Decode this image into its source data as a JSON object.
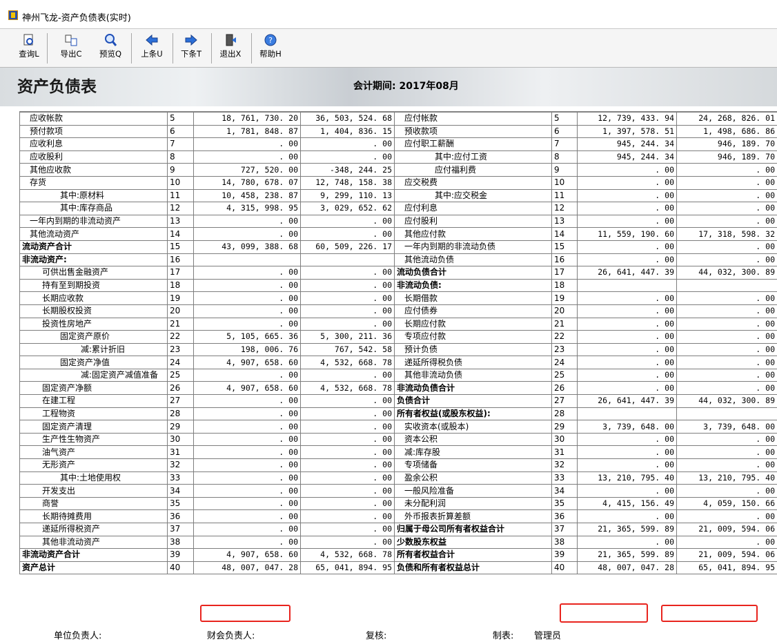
{
  "window": {
    "title": "神州飞龙-资产负债表(实时)"
  },
  "toolbar": [
    {
      "label": "查询L",
      "icon": "magnify-doc-icon"
    },
    {
      "label": "导出C",
      "icon": "export-icon"
    },
    {
      "label": "预览Q",
      "icon": "preview-magnifier-icon"
    },
    {
      "label": "上条U",
      "icon": "arrow-left-icon"
    },
    {
      "label": "下条T",
      "icon": "arrow-right-icon"
    },
    {
      "label": "退出X",
      "icon": "exit-door-icon"
    },
    {
      "label": "帮助H",
      "icon": "help-icon"
    }
  ],
  "banner": {
    "title": "资产负债表",
    "period": "会计期间: 2017年08月"
  },
  "rows": [
    {
      "ln": "应收帐款",
      "li": 1,
      "lb": false,
      "lr": "5",
      "lv1": "18, 761, 730. 20",
      "lv2": "36, 503, 524. 68",
      "rn": "应付帐款",
      "ri": 1,
      "rb": false,
      "rr": "5",
      "rv1": "12, 739, 433. 94",
      "rv2": "24, 268, 826. 01"
    },
    {
      "ln": "预付款项",
      "li": 1,
      "lb": false,
      "lr": "6",
      "lv1": "1, 781, 848. 87",
      "lv2": "1, 404, 836. 15",
      "rn": "预收款项",
      "ri": 1,
      "rb": false,
      "rr": "6",
      "rv1": "1, 397, 578. 51",
      "rv2": "1, 498, 686. 86"
    },
    {
      "ln": "应收利息",
      "li": 1,
      "lb": false,
      "lr": "7",
      "lv1": ". 00",
      "lv2": ". 00",
      "rn": "应付职工薪酬",
      "ri": 1,
      "rb": false,
      "rr": "7",
      "rv1": "945, 244. 34",
      "rv2": "946, 189. 70"
    },
    {
      "ln": "应收股利",
      "li": 1,
      "lb": false,
      "lr": "8",
      "lv1": ". 00",
      "lv2": ". 00",
      "rn": "其中:应付工资",
      "ri": 3,
      "rb": false,
      "rr": "8",
      "rv1": "945, 244. 34",
      "rv2": "946, 189. 70"
    },
    {
      "ln": "其他应收款",
      "li": 1,
      "lb": false,
      "lr": "9",
      "lv1": "727, 520. 00",
      "lv2": "-348, 244. 25",
      "rn": "应付福利费",
      "ri": 3,
      "rb": false,
      "rr": "9",
      "rv1": ". 00",
      "rv2": ". 00"
    },
    {
      "ln": "存货",
      "li": 1,
      "lb": false,
      "lr": "10",
      "lv1": "14, 780, 678. 07",
      "lv2": "12, 748, 158. 38",
      "rn": "应交税费",
      "ri": 1,
      "rb": false,
      "rr": "10",
      "rv1": ". 00",
      "rv2": ". 00"
    },
    {
      "ln": "其中:原材料",
      "li": 3,
      "lb": false,
      "lr": "11",
      "lv1": "10, 458, 238. 87",
      "lv2": "9, 299, 110. 13",
      "rn": "其中:应交税金",
      "ri": 3,
      "rb": false,
      "rr": "11",
      "rv1": ". 00",
      "rv2": ". 00"
    },
    {
      "ln": "其中:库存商品",
      "li": 3,
      "lb": false,
      "lr": "12",
      "lv1": "4, 315, 998. 95",
      "lv2": "3, 029, 652. 62",
      "rn": "应付利息",
      "ri": 1,
      "rb": false,
      "rr": "12",
      "rv1": ". 00",
      "rv2": ". 00"
    },
    {
      "ln": "一年内到期的非流动资产",
      "li": 1,
      "lb": false,
      "lr": "13",
      "lv1": ". 00",
      "lv2": ". 00",
      "rn": "应付股利",
      "ri": 1,
      "rb": false,
      "rr": "13",
      "rv1": ". 00",
      "rv2": ". 00"
    },
    {
      "ln": "其他流动资产",
      "li": 1,
      "lb": false,
      "lr": "14",
      "lv1": ". 00",
      "lv2": ". 00",
      "rn": "其他应付款",
      "ri": 1,
      "rb": false,
      "rr": "14",
      "rv1": "11, 559, 190. 60",
      "rv2": "17, 318, 598. 32"
    },
    {
      "ln": "流动资产合计",
      "li": 0,
      "lb": true,
      "lr": "15",
      "lv1": "43, 099, 388. 68",
      "lv2": "60, 509, 226. 17",
      "rn": "一年内到期的非流动负债",
      "ri": 1,
      "rb": false,
      "rr": "15",
      "rv1": ". 00",
      "rv2": ". 00"
    },
    {
      "ln": "非流动资产:",
      "li": 0,
      "lb": true,
      "lr": "16",
      "lv1": "",
      "lv2": "",
      "rn": "其他流动负债",
      "ri": 1,
      "rb": false,
      "rr": "16",
      "rv1": ". 00",
      "rv2": ". 00"
    },
    {
      "ln": "可供出售金融资产",
      "li": 2,
      "lb": false,
      "lr": "17",
      "lv1": ". 00",
      "lv2": ". 00",
      "rn": "流动负债合计",
      "ri": 0,
      "rb": true,
      "rr": "17",
      "rv1": "26, 641, 447. 39",
      "rv2": "44, 032, 300. 89"
    },
    {
      "ln": "持有至到期投资",
      "li": 2,
      "lb": false,
      "lr": "18",
      "lv1": ". 00",
      "lv2": ". 00",
      "rn": "非流动负债:",
      "ri": 0,
      "rb": true,
      "rr": "18",
      "rv1": "",
      "rv2": ""
    },
    {
      "ln": "长期应收款",
      "li": 2,
      "lb": false,
      "lr": "19",
      "lv1": ". 00",
      "lv2": ". 00",
      "rn": "长期借款",
      "ri": 1,
      "rb": false,
      "rr": "19",
      "rv1": ". 00",
      "rv2": ". 00"
    },
    {
      "ln": "长期股权投资",
      "li": 2,
      "lb": false,
      "lr": "20",
      "lv1": ". 00",
      "lv2": ". 00",
      "rn": "应付债券",
      "ri": 1,
      "rb": false,
      "rr": "20",
      "rv1": ". 00",
      "rv2": ". 00"
    },
    {
      "ln": "投资性房地产",
      "li": 2,
      "lb": false,
      "lr": "21",
      "lv1": ". 00",
      "lv2": ". 00",
      "rn": "长期应付款",
      "ri": 1,
      "rb": false,
      "rr": "21",
      "rv1": ". 00",
      "rv2": ". 00"
    },
    {
      "ln": "固定资产原价",
      "li": 3,
      "lb": false,
      "lr": "22",
      "lv1": "5, 105, 665. 36",
      "lv2": "5, 300, 211. 36",
      "rn": "专项应付款",
      "ri": 1,
      "rb": false,
      "rr": "22",
      "rv1": ". 00",
      "rv2": ". 00"
    },
    {
      "ln": "减:累计折旧",
      "li": 4,
      "lb": false,
      "lr": "23",
      "lv1": "198, 006. 76",
      "lv2": "767, 542. 58",
      "rn": "预计负债",
      "ri": 1,
      "rb": false,
      "rr": "23",
      "rv1": ". 00",
      "rv2": ". 00"
    },
    {
      "ln": "固定资产净值",
      "li": 3,
      "lb": false,
      "lr": "24",
      "lv1": "4, 907, 658. 60",
      "lv2": "4, 532, 668. 78",
      "rn": "递延所得税负债",
      "ri": 1,
      "rb": false,
      "rr": "24",
      "rv1": ". 00",
      "rv2": ". 00"
    },
    {
      "ln": "减:固定资产减值准备",
      "li": 4,
      "lb": false,
      "lr": "25",
      "lv1": ". 00",
      "lv2": ". 00",
      "rn": "其他非流动负债",
      "ri": 1,
      "rb": false,
      "rr": "25",
      "rv1": ". 00",
      "rv2": ". 00"
    },
    {
      "ln": "固定资产净额",
      "li": 2,
      "lb": false,
      "lr": "26",
      "lv1": "4, 907, 658. 60",
      "lv2": "4, 532, 668. 78",
      "rn": "非流动负债合计",
      "ri": 0,
      "rb": true,
      "rr": "26",
      "rv1": ". 00",
      "rv2": ". 00"
    },
    {
      "ln": "在建工程",
      "li": 2,
      "lb": false,
      "lr": "27",
      "lv1": ". 00",
      "lv2": ". 00",
      "rn": "负债合计",
      "ri": 0,
      "rb": true,
      "rr": "27",
      "rv1": "26, 641, 447. 39",
      "rv2": "44, 032, 300. 89"
    },
    {
      "ln": "工程物资",
      "li": 2,
      "lb": false,
      "lr": "28",
      "lv1": ". 00",
      "lv2": ". 00",
      "rn": "所有者权益(或股东权益):",
      "ri": 0,
      "rb": true,
      "rr": "28",
      "rv1": "",
      "rv2": ""
    },
    {
      "ln": "固定资产清理",
      "li": 2,
      "lb": false,
      "lr": "29",
      "lv1": ". 00",
      "lv2": ". 00",
      "rn": "实收资本(或股本)",
      "ri": 1,
      "rb": false,
      "rr": "29",
      "rv1": "3, 739, 648. 00",
      "rv2": "3, 739, 648. 00"
    },
    {
      "ln": "生产性生物资产",
      "li": 2,
      "lb": false,
      "lr": "30",
      "lv1": ". 00",
      "lv2": ". 00",
      "rn": "资本公积",
      "ri": 1,
      "rb": false,
      "rr": "30",
      "rv1": ". 00",
      "rv2": ". 00"
    },
    {
      "ln": "油气资产",
      "li": 2,
      "lb": false,
      "lr": "31",
      "lv1": ". 00",
      "lv2": ". 00",
      "rn": "减:库存股",
      "ri": 1,
      "rb": false,
      "rr": "31",
      "rv1": ". 00",
      "rv2": ". 00"
    },
    {
      "ln": "无形资产",
      "li": 2,
      "lb": false,
      "lr": "32",
      "lv1": ". 00",
      "lv2": ". 00",
      "rn": "专项储备",
      "ri": 1,
      "rb": false,
      "rr": "32",
      "rv1": ". 00",
      "rv2": ". 00"
    },
    {
      "ln": "其中:土地使用权",
      "li": 3,
      "lb": false,
      "lr": "33",
      "lv1": ". 00",
      "lv2": ". 00",
      "rn": "盈余公积",
      "ri": 1,
      "rb": false,
      "rr": "33",
      "rv1": "13, 210, 795. 40",
      "rv2": "13, 210, 795. 40"
    },
    {
      "ln": "开发支出",
      "li": 2,
      "lb": false,
      "lr": "34",
      "lv1": ". 00",
      "lv2": ". 00",
      "rn": "一般风险准备",
      "ri": 1,
      "rb": false,
      "rr": "34",
      "rv1": ". 00",
      "rv2": ". 00"
    },
    {
      "ln": "商誉",
      "li": 2,
      "lb": false,
      "lr": "35",
      "lv1": ". 00",
      "lv2": ". 00",
      "rn": "未分配利润",
      "ri": 1,
      "rb": false,
      "rr": "35",
      "rv1": "4, 415, 156. 49",
      "rv2": "4, 059, 150. 66"
    },
    {
      "ln": "长期待摊费用",
      "li": 2,
      "lb": false,
      "lr": "36",
      "lv1": ". 00",
      "lv2": ". 00",
      "rn": "外币报表折算差额",
      "ri": 1,
      "rb": false,
      "rr": "36",
      "rv1": ". 00",
      "rv2": ". 00"
    },
    {
      "ln": "递延所得税资产",
      "li": 2,
      "lb": false,
      "lr": "37",
      "lv1": ". 00",
      "lv2": ". 00",
      "rn": "归属于母公司所有者权益合计",
      "ri": 0,
      "rb": true,
      "rr": "37",
      "rv1": "21, 365, 599. 89",
      "rv2": "21, 009, 594. 06"
    },
    {
      "ln": "其他非流动资产",
      "li": 2,
      "lb": false,
      "lr": "38",
      "lv1": ". 00",
      "lv2": ". 00",
      "rn": "少数股东权益",
      "ri": 0,
      "rb": true,
      "rr": "38",
      "rv1": ". 00",
      "rv2": ". 00"
    },
    {
      "ln": "非流动资产合计",
      "li": 0,
      "lb": true,
      "lr": "39",
      "lv1": "4, 907, 658. 60",
      "lv2": "4, 532, 668. 78",
      "rn": "所有者权益合计",
      "ri": 0,
      "rb": true,
      "rr": "39",
      "rv1": "21, 365, 599. 89",
      "rv2": "21, 009, 594. 06"
    },
    {
      "ln": "资产总计",
      "li": 0,
      "lb": true,
      "lr": "40",
      "lv1": "48, 007, 047. 28",
      "lv2": "65, 041, 894. 95",
      "rn": "负债和所有者权益总计",
      "ri": 0,
      "rb": true,
      "rr": "40",
      "rv1": "48, 007, 047. 28",
      "rv2": "65, 041, 894. 95"
    }
  ],
  "footer": {
    "unit_head": "单位负责人:",
    "finance_head": "财会负责人:",
    "reviewer": "复核:",
    "preparer_label": "制表:",
    "preparer": "管理员"
  },
  "colors": {
    "highlight": "#e8231d"
  }
}
